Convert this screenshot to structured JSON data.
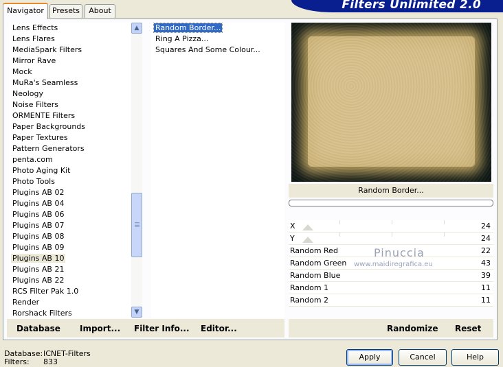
{
  "banner": {
    "title": "Filters Unlimited 2.0"
  },
  "tabs": [
    {
      "label": "Navigator",
      "active": true
    },
    {
      "label": "Presets"
    },
    {
      "label": "About"
    }
  ],
  "categories": [
    "Lens Effects",
    "Lens Flares",
    "MediaSpark Filters",
    "Mirror Rave",
    "Mock",
    "MuRa's Seamless",
    "Neology",
    "Noise Filters",
    "ORMENTE Filters",
    "Paper Backgrounds",
    "Paper Textures",
    "Pattern Generators",
    "penta.com",
    "Photo Aging Kit",
    "Photo Tools",
    "Plugins AB 02",
    "Plugins AB 04",
    "Plugins AB 06",
    "Plugins AB 07",
    "Plugins AB 08",
    "Plugins AB 09",
    "Plugins AB 10",
    "Plugins AB 21",
    "Plugins AB 22",
    "RCS Filter Pak 1.0",
    "Render",
    "Rorshack Filters"
  ],
  "selected_category": "Plugins AB 10",
  "filters": [
    "Random Border...",
    "Ring A Pizza...",
    "Squares And Some Colour..."
  ],
  "selected_filter": "Random Border...",
  "preview": {
    "filter_name": "Random Border..."
  },
  "parameters": [
    {
      "label": "X",
      "value": "24",
      "slider": true
    },
    {
      "label": "Y",
      "value": "24",
      "slider": true
    },
    {
      "label": "Random Red",
      "value": "22"
    },
    {
      "label": "Random Green",
      "value": "43"
    },
    {
      "label": "Random Blue",
      "value": "39"
    },
    {
      "label": "Random 1",
      "value": "11"
    },
    {
      "label": "Random 2",
      "value": "11"
    }
  ],
  "watermark": {
    "line1": "Pinuccia",
    "line2": "www.maidiregrafica.eu"
  },
  "links": {
    "database": "Database",
    "import": "Import...",
    "filter_info": "Filter Info...",
    "editor": "Editor...",
    "randomize": "Randomize",
    "reset": "Reset"
  },
  "status": {
    "database_label": "Database:",
    "database_value": "ICNET-Filters",
    "filters_label": "Filters:",
    "filters_value": "833"
  },
  "buttons": {
    "apply": "Apply",
    "cancel": "Cancel",
    "help": "Help"
  }
}
